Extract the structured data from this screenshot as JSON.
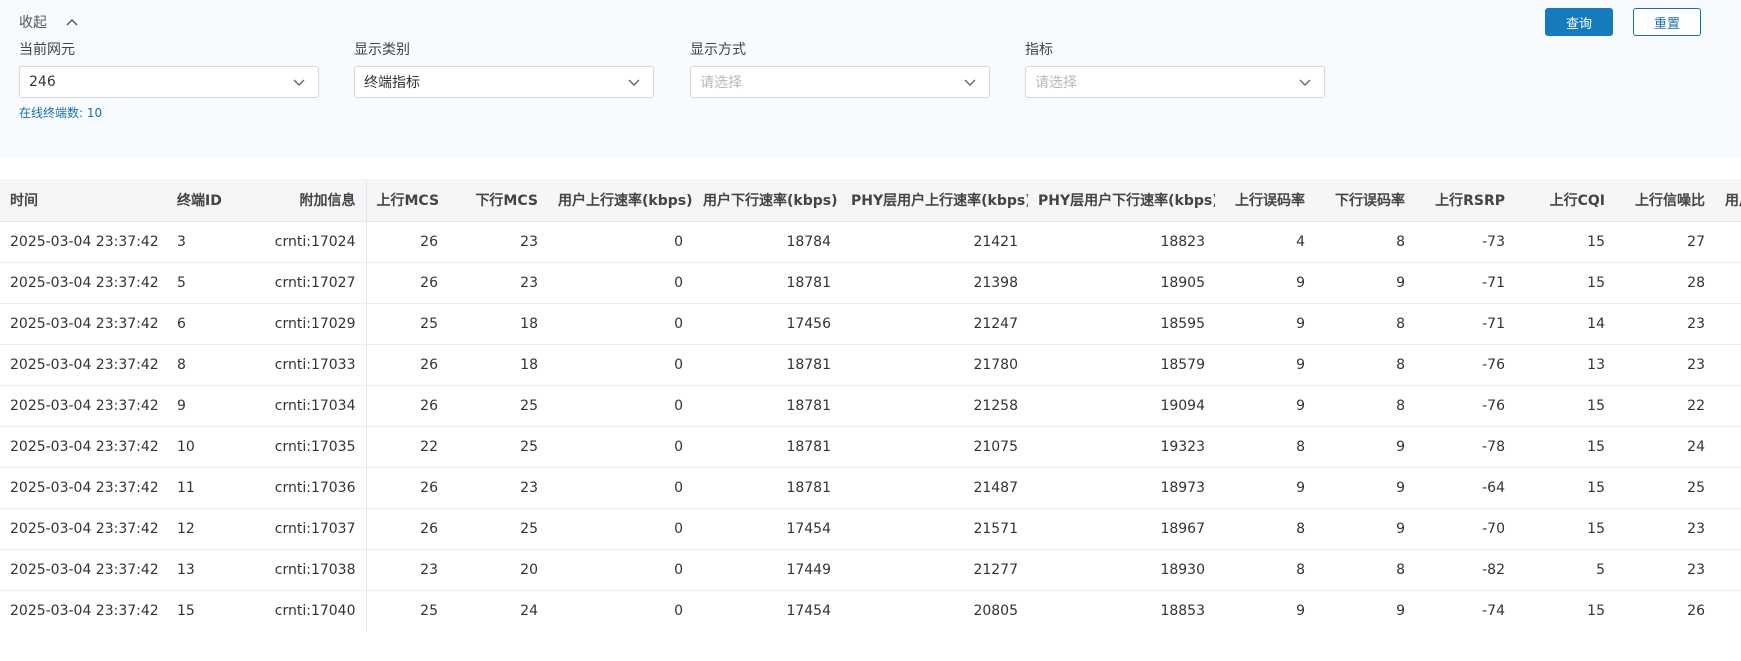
{
  "filters": {
    "collapse_label": "收起",
    "ne": {
      "label": "当前网元",
      "value": "246"
    },
    "category": {
      "label": "显示类别",
      "value": "终端指标"
    },
    "mode": {
      "label": "显示方式",
      "placeholder": "请选择"
    },
    "metric": {
      "label": "指标",
      "placeholder": "请选择"
    },
    "online_text": "在线终端数: 10"
  },
  "buttons": {
    "query": "查询",
    "reset": "重置"
  },
  "table": {
    "columns": [
      "时间",
      "终端ID",
      "附加信息",
      "上行MCS",
      "下行MCS",
      "用户上行速率(kbps)",
      "用户下行速率(kbps)",
      "PHY层用户上行速率(kbps)",
      "PHY层用户下行速率(kbps)",
      "上行误码率",
      "下行误码率",
      "上行RSRP",
      "上行CQI",
      "上行信噪比",
      "用户"
    ],
    "rows": [
      [
        "2025-03-04 23:37:42",
        "3",
        "crnti:17024",
        "26",
        "23",
        "0",
        "18784",
        "21421",
        "18823",
        "4",
        "8",
        "-73",
        "15",
        "27"
      ],
      [
        "2025-03-04 23:37:42",
        "5",
        "crnti:17027",
        "26",
        "23",
        "0",
        "18781",
        "21398",
        "18905",
        "9",
        "9",
        "-71",
        "15",
        "28"
      ],
      [
        "2025-03-04 23:37:42",
        "6",
        "crnti:17029",
        "25",
        "18",
        "0",
        "17456",
        "21247",
        "18595",
        "9",
        "8",
        "-71",
        "14",
        "23"
      ],
      [
        "2025-03-04 23:37:42",
        "8",
        "crnti:17033",
        "26",
        "18",
        "0",
        "18781",
        "21780",
        "18579",
        "9",
        "8",
        "-76",
        "13",
        "23"
      ],
      [
        "2025-03-04 23:37:42",
        "9",
        "crnti:17034",
        "26",
        "25",
        "0",
        "18781",
        "21258",
        "19094",
        "9",
        "8",
        "-76",
        "15",
        "22"
      ],
      [
        "2025-03-04 23:37:42",
        "10",
        "crnti:17035",
        "22",
        "25",
        "0",
        "18781",
        "21075",
        "19323",
        "8",
        "9",
        "-78",
        "15",
        "24"
      ],
      [
        "2025-03-04 23:37:42",
        "11",
        "crnti:17036",
        "26",
        "23",
        "0",
        "18781",
        "21487",
        "18973",
        "9",
        "9",
        "-64",
        "15",
        "25"
      ],
      [
        "2025-03-04 23:37:42",
        "12",
        "crnti:17037",
        "26",
        "25",
        "0",
        "17454",
        "21571",
        "18967",
        "8",
        "9",
        "-70",
        "15",
        "23"
      ],
      [
        "2025-03-04 23:37:42",
        "13",
        "crnti:17038",
        "23",
        "20",
        "0",
        "17449",
        "21277",
        "18930",
        "8",
        "8",
        "-82",
        "5",
        "23"
      ],
      [
        "2025-03-04 23:37:42",
        "15",
        "crnti:17040",
        "25",
        "24",
        "0",
        "17454",
        "20805",
        "18853",
        "9",
        "9",
        "-74",
        "15",
        "26"
      ]
    ]
  },
  "colors": {
    "primary": "#167bbd",
    "panel_bg": "#f7fbfe",
    "header_bg": "#f5f6f8"
  }
}
